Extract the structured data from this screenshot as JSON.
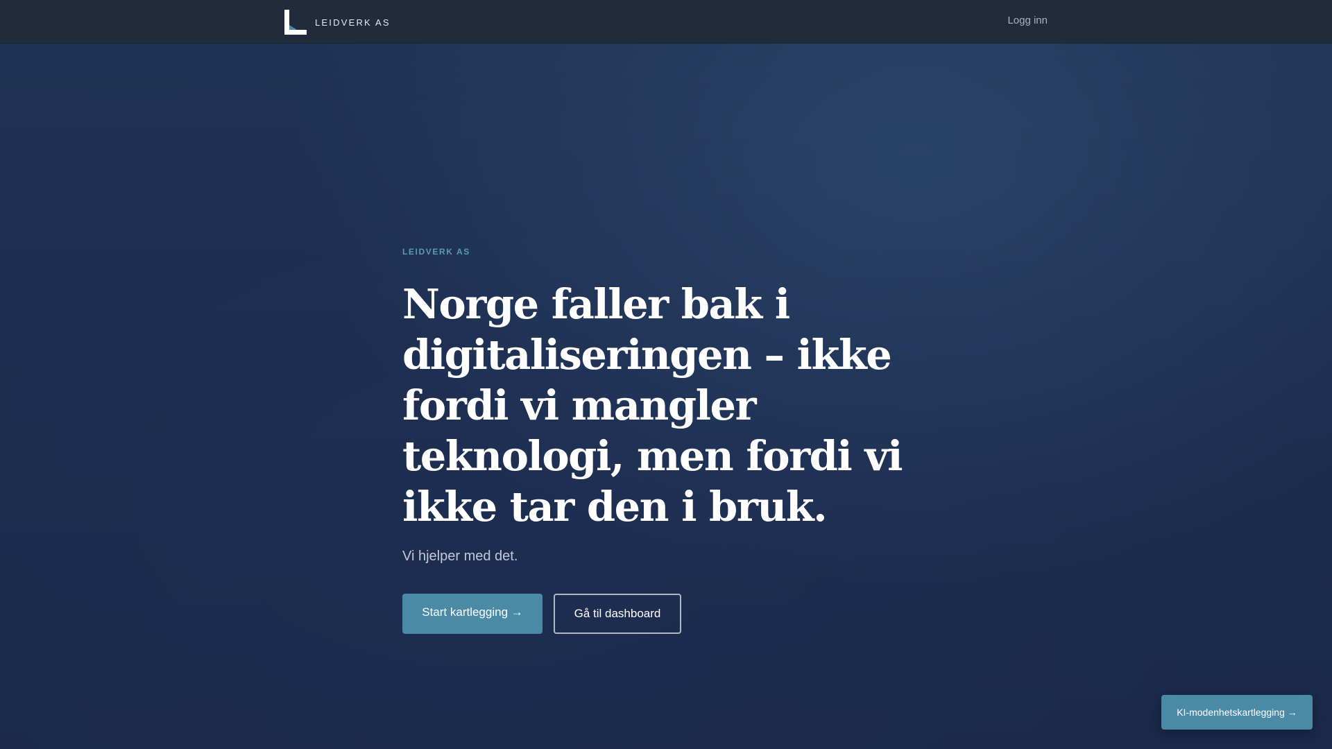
{
  "header": {
    "brand_name": "LEIDVERK AS",
    "logo_icon": "leidverk-l-logo-icon",
    "login_label": "Logg inn"
  },
  "hero": {
    "eyebrow": "LEIDVERK AS",
    "headline": "Norge faller bak i digitaliseringen – ikke fordi vi mangler teknologi, men fordi vi ikke tar den i bruk.",
    "lead": "Vi hjelper med det.",
    "primary_button": "Start kartlegging →",
    "secondary_button": "Gå til dashboard"
  },
  "floating_button": {
    "label": "KI-modenhetskartlegging →"
  },
  "colors": {
    "background": "#1c2d4e",
    "topbar": "#212b3b",
    "accent": "#4a8aa6",
    "eyebrow": "#5b9bb4"
  }
}
